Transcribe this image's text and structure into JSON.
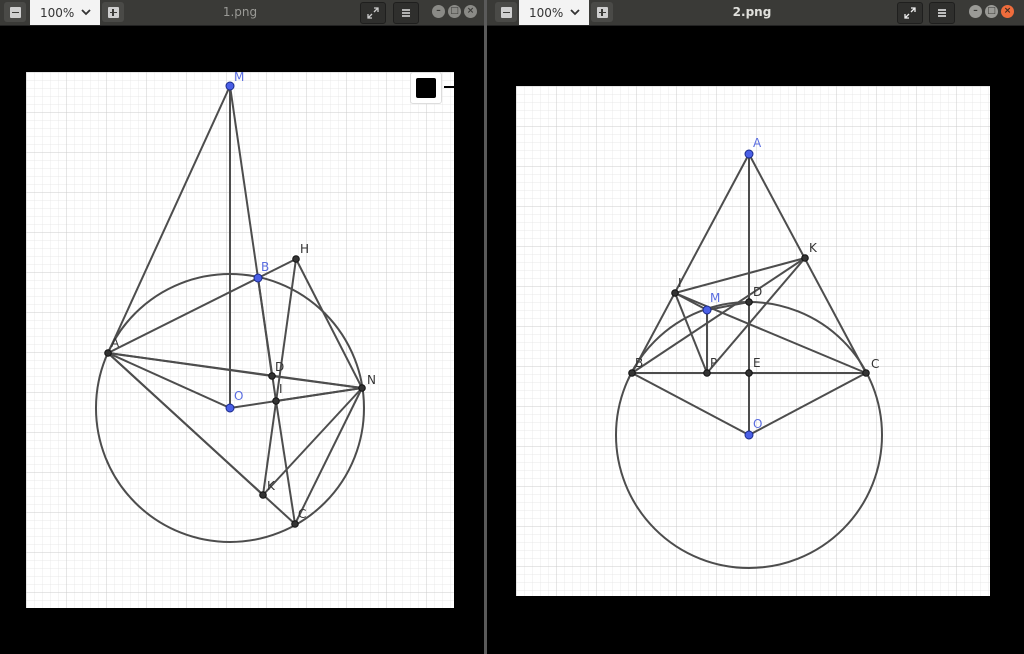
{
  "windows": [
    {
      "title": "1.png",
      "zoom": "100%",
      "points": [
        {
          "label": "M",
          "color": "blue"
        },
        {
          "label": "B",
          "color": "blue"
        },
        {
          "label": "H",
          "color": "black"
        },
        {
          "label": "A",
          "color": "black"
        },
        {
          "label": "D",
          "color": "black"
        },
        {
          "label": "N",
          "color": "black"
        },
        {
          "label": "I",
          "color": "black"
        },
        {
          "label": "O",
          "color": "blue"
        },
        {
          "label": "K",
          "color": "black"
        },
        {
          "label": "C",
          "color": "black"
        }
      ]
    },
    {
      "title": "2.png",
      "zoom": "100%",
      "points": [
        {
          "label": "A",
          "color": "blue"
        },
        {
          "label": "K",
          "color": "black"
        },
        {
          "label": "I",
          "color": "black"
        },
        {
          "label": "M",
          "color": "blue"
        },
        {
          "label": "D",
          "color": "black"
        },
        {
          "label": "B",
          "color": "black"
        },
        {
          "label": "P",
          "color": "black"
        },
        {
          "label": "E",
          "color": "black"
        },
        {
          "label": "C",
          "color": "black"
        },
        {
          "label": "O",
          "color": "blue"
        }
      ]
    }
  ],
  "colors": {
    "titlebar": "#3a3a37",
    "point_blue": "#4a5fe6",
    "label_blue": "#5b6ee0",
    "stroke": "#4d4d4d",
    "close_button": "#ef6c3c"
  },
  "icons": [
    "zoom-out-icon",
    "chevron-down-icon",
    "zoom-in-icon",
    "fullscreen-icon",
    "menu-icon",
    "minimize-icon",
    "maximize-icon",
    "close-icon"
  ]
}
